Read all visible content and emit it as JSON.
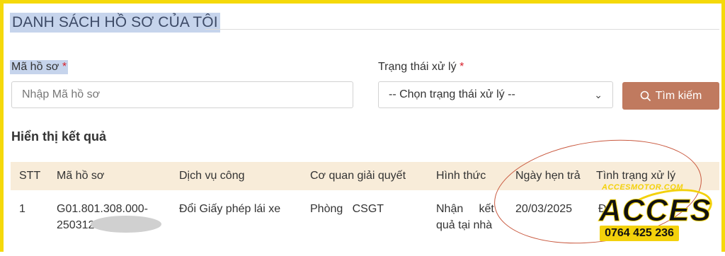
{
  "page": {
    "title": "DANH SÁCH HỒ SƠ CỦA TÔI"
  },
  "filters": {
    "code_label": "Mã hồ sơ",
    "code_required": "*",
    "code_placeholder": "Nhập Mã hồ sơ",
    "status_label": "Trạng thái xử lý",
    "status_required": "*",
    "status_selected": "-- Chọn trạng thái xử lý --",
    "search_label": "Tìm kiếm"
  },
  "results": {
    "heading": "Hiển thị kết quả",
    "columns": [
      "STT",
      "Mã hồ sơ",
      "Dịch vụ công",
      "Cơ quan giải quyết",
      "Hình thức",
      "Ngày hẹn trả",
      "Tình trạng xử lý"
    ],
    "rows": [
      {
        "stt": "1",
        "code_line1": "G01.801.308.000-",
        "code_line2": "250312",
        "service": "Đổi Giấy phép lái xe",
        "agency": "Phòng   CSGT",
        "method_line1": "Nhận     kết",
        "method_line2": "quả tại nhà",
        "due_date": "20/03/2025",
        "status": "Đ"
      }
    ]
  },
  "watermark": {
    "site": "ACCESMOTOR.COM",
    "brand": "ACCES",
    "phone": "0764 425 236"
  },
  "colors": {
    "frame": "#f5d90a",
    "title_highlight": "#c6d4ec",
    "button": "#c07a5f",
    "table_header": "#f8ecd9",
    "annotation_oval": "#c9593f"
  }
}
